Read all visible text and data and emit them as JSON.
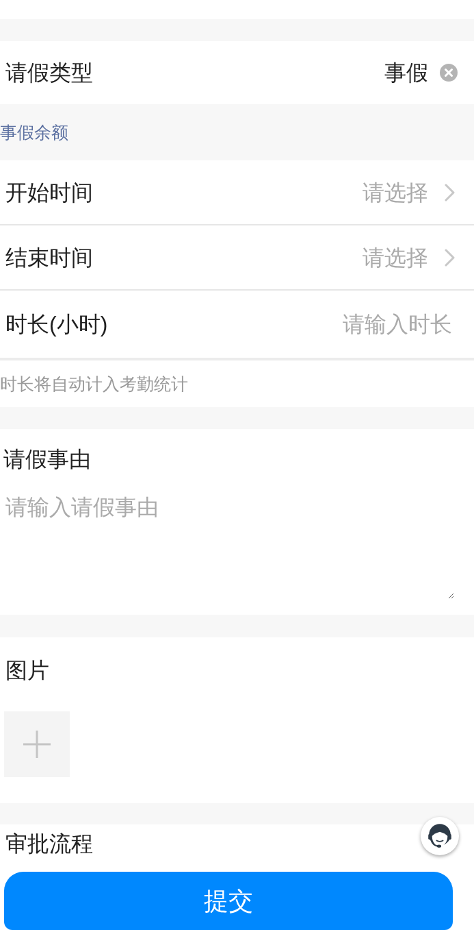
{
  "leave_type": {
    "label": "请假类型",
    "value": "事假"
  },
  "balance_note": "事假余额",
  "fields": [
    {
      "kind": "picker",
      "label": "开始时间",
      "placeholder": "请选择"
    },
    {
      "kind": "picker",
      "label": "结束时间",
      "placeholder": "请选择"
    },
    {
      "kind": "input",
      "label": "时长(小时)",
      "placeholder": "请输入时长"
    }
  ],
  "duration_hint": "时长将自动计入考勤统计",
  "reason": {
    "label": "请假事由",
    "placeholder": "请输入请假事由"
  },
  "images": {
    "label": "图片"
  },
  "approval": {
    "label": "审批流程"
  },
  "submit_button": {
    "label": "提交"
  }
}
